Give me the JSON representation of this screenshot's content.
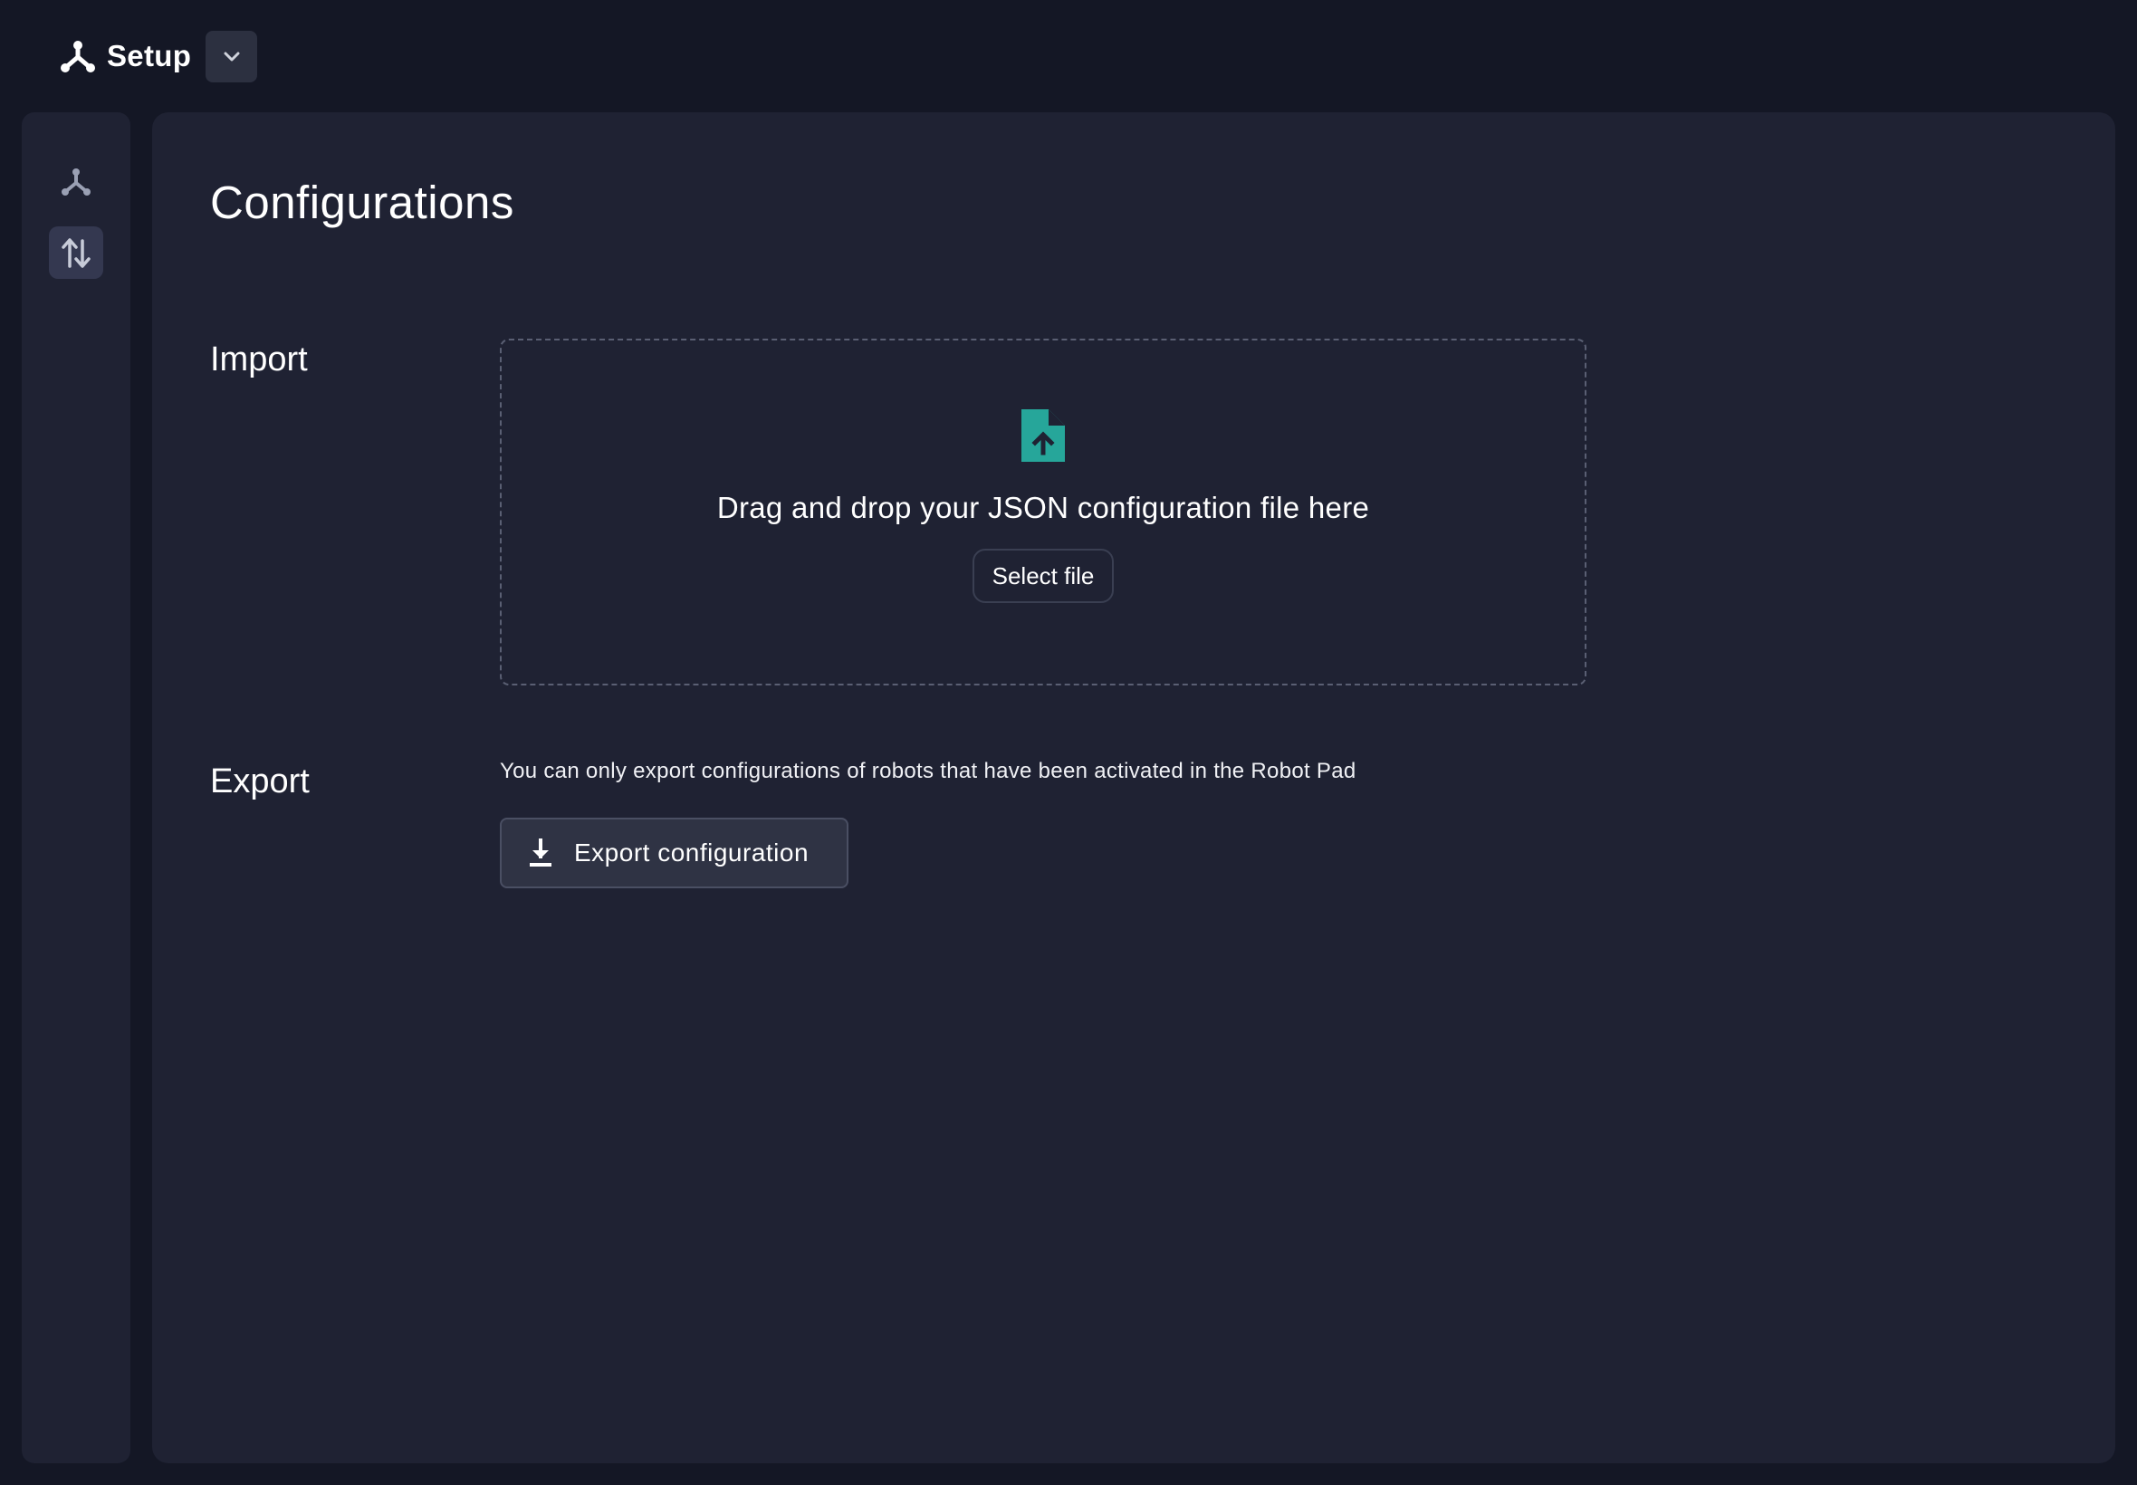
{
  "app": {
    "title": "Setup",
    "logo_icon": "network-icon"
  },
  "sidebar": {
    "items": [
      {
        "icon": "network-icon",
        "active": false
      },
      {
        "icon": "import-export-icon",
        "active": true
      }
    ]
  },
  "main": {
    "title": "Configurations",
    "import": {
      "label": "Import",
      "drop_text": "Drag and drop your JSON configuration file here",
      "select_button": "Select file",
      "icon": "file-upload-icon",
      "icon_color": "#26a69a"
    },
    "export": {
      "label": "Export",
      "note": "You can only export configurations of robots that have been activated in the Robot Pad",
      "button": "Export configuration",
      "icon": "download-icon"
    }
  }
}
